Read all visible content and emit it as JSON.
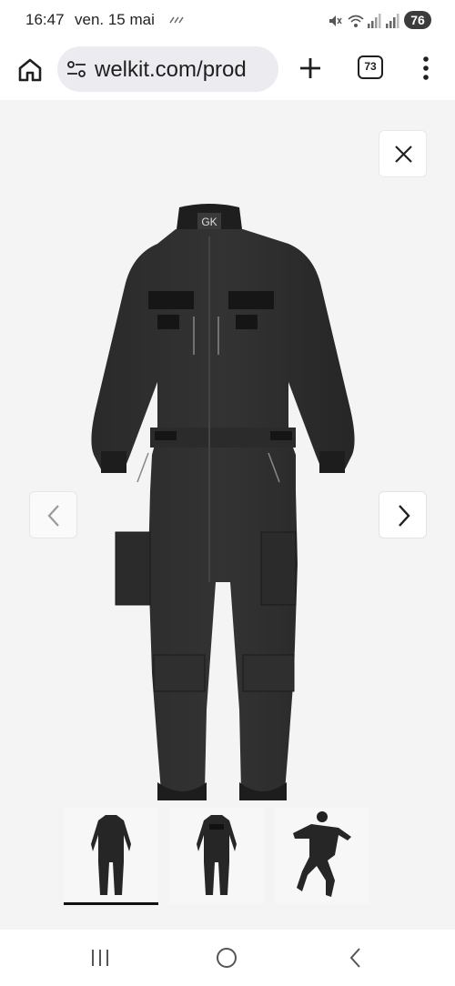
{
  "status_bar": {
    "time": "16:47",
    "date": "ven. 15 mai",
    "battery": "76",
    "icons": [
      "activity-icon",
      "mute-icon",
      "wifi-icon",
      "signal-icon",
      "signal-icon"
    ]
  },
  "browser": {
    "url": "welkit.com/prod",
    "tab_count": "73",
    "icons": [
      "home-icon",
      "site-settings-icon",
      "plus-icon",
      "tabs-icon",
      "more-vert-icon"
    ]
  },
  "gallery": {
    "product_logo": "GK",
    "thumbnails_count": 3,
    "active_thumbnail": 0,
    "icons": [
      "close-icon",
      "chevron-left-icon",
      "chevron-right-icon"
    ]
  },
  "system_nav": {
    "icons": [
      "recents-icon",
      "home-circle-icon",
      "back-icon"
    ]
  }
}
